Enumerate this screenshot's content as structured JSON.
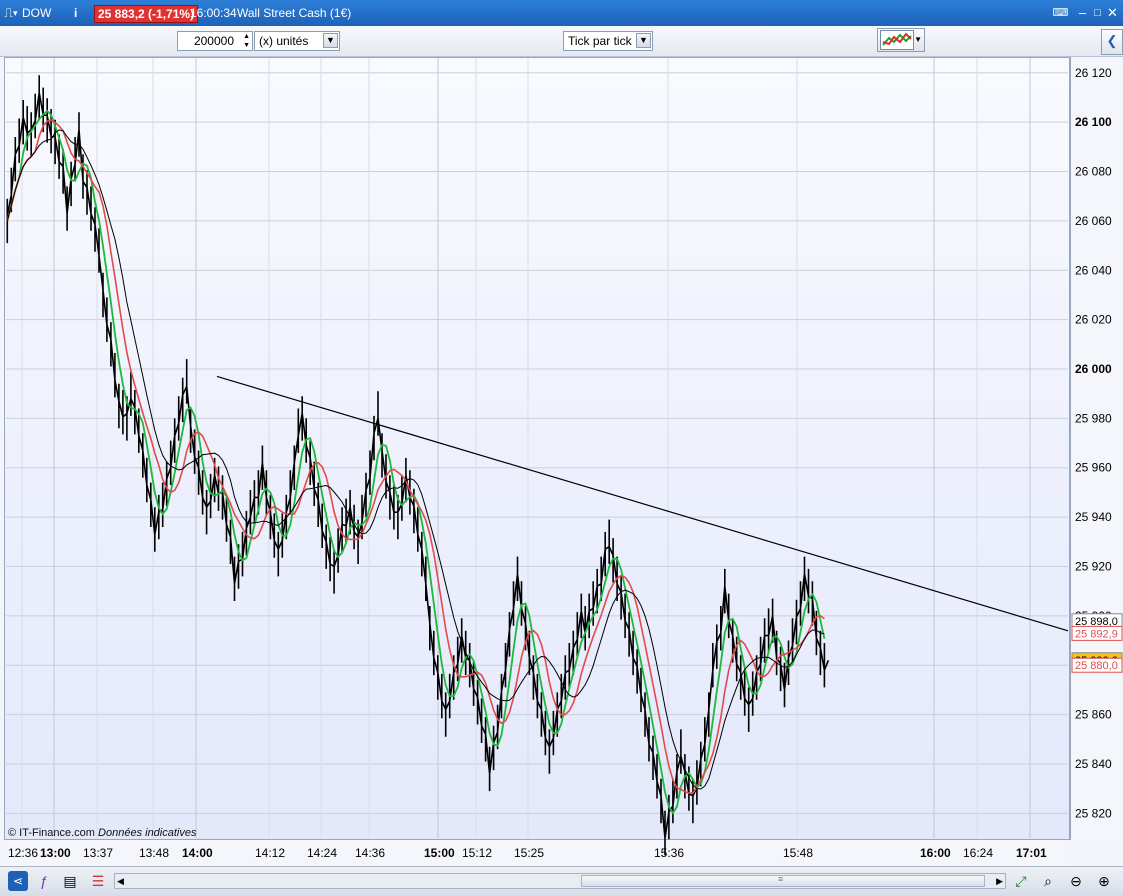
{
  "window": {
    "symbol": "DOW",
    "price_badge": "25 883,2 (-1,71%)",
    "time": "16:00:34",
    "instrument": "Wall Street Cash (1€)"
  },
  "toolbar": {
    "quantity_value": "200000",
    "unit_select": "(x) unités",
    "interval_select": "Tick par tick"
  },
  "footer": {
    "copyright": "© IT-Finance.com",
    "disclaimer": "Données indicatives"
  },
  "colors": {
    "price_badge": "#e23131",
    "ma_fast": "#1fb83a",
    "ma_medium": "#e24b4b",
    "ma_slow": "#000000",
    "current_price_badge": "#f5c518"
  },
  "chart_data": {
    "type": "line",
    "title": "",
    "xlabel": "",
    "ylabel": "",
    "ylim": [
      25810,
      26126
    ],
    "y_ticks": [
      25820,
      25840,
      25860,
      25880,
      25900,
      25920,
      25940,
      25960,
      25980,
      26000,
      26020,
      26040,
      26060,
      26080,
      26100,
      26120
    ],
    "y_tick_labels": [
      "25 820",
      "25 840",
      "25 860",
      "25 880",
      "25 900",
      "25 920",
      "25 940",
      "25 960",
      "25 980",
      "26 000",
      "26 020",
      "26 040",
      "26 060",
      "26 080",
      "26 100",
      "26 120"
    ],
    "x_tick_labels": [
      "12:36",
      "13:00",
      "13:37",
      "13:48",
      "14:00",
      "14:12",
      "14:24",
      "14:36",
      "15:00",
      "15:12",
      "15:25",
      "15:36",
      "15:48",
      "16:00",
      "16:24",
      "17:01"
    ],
    "bold_x_ticks": [
      "13:00",
      "14:00",
      "15:00",
      "16:00",
      "17:01"
    ],
    "bold_y_ticks": [
      26000,
      26100
    ],
    "series": [
      {
        "style": "tick-bars",
        "points": [
          [
            0,
            26060
          ],
          [
            2,
            26085
          ],
          [
            4,
            26100
          ],
          [
            6,
            26095
          ],
          [
            8,
            26110
          ],
          [
            9,
            26105
          ],
          [
            12,
            26092
          ],
          [
            14,
            26080
          ],
          [
            15,
            26065
          ],
          [
            17,
            26085
          ],
          [
            18,
            26095
          ],
          [
            19,
            26078
          ],
          [
            21,
            26065
          ],
          [
            23,
            26048
          ],
          [
            24,
            26030
          ],
          [
            26,
            26010
          ],
          [
            28,
            25985
          ],
          [
            30,
            25980
          ],
          [
            31,
            25990
          ],
          [
            33,
            25975
          ],
          [
            35,
            25955
          ],
          [
            37,
            25935
          ],
          [
            39,
            25945
          ],
          [
            41,
            25962
          ],
          [
            43,
            25980
          ],
          [
            45,
            25995
          ],
          [
            46,
            25975
          ],
          [
            48,
            25958
          ],
          [
            50,
            25942
          ],
          [
            52,
            25955
          ],
          [
            54,
            25948
          ],
          [
            56,
            25930
          ],
          [
            57,
            25915
          ],
          [
            59,
            25925
          ],
          [
            61,
            25942
          ],
          [
            63,
            25950
          ],
          [
            64,
            25960
          ],
          [
            66,
            25940
          ],
          [
            68,
            25925
          ],
          [
            70,
            25940
          ],
          [
            72,
            25960
          ],
          [
            73,
            25975
          ],
          [
            74,
            25980
          ],
          [
            76,
            25962
          ],
          [
            78,
            25945
          ],
          [
            80,
            25928
          ],
          [
            82,
            25918
          ],
          [
            84,
            25935
          ],
          [
            86,
            25942
          ],
          [
            88,
            25930
          ],
          [
            89,
            25940
          ],
          [
            91,
            25958
          ],
          [
            92,
            25972
          ],
          [
            93,
            25982
          ],
          [
            94,
            25965
          ],
          [
            96,
            25948
          ],
          [
            98,
            25940
          ],
          [
            100,
            25955
          ],
          [
            101,
            25950
          ],
          [
            103,
            25935
          ],
          [
            105,
            25915
          ],
          [
            106,
            25895
          ],
          [
            108,
            25875
          ],
          [
            110,
            25860
          ],
          [
            112,
            25875
          ],
          [
            114,
            25890
          ],
          [
            116,
            25880
          ],
          [
            118,
            25865
          ],
          [
            120,
            25850
          ],
          [
            121,
            25838
          ],
          [
            123,
            25855
          ],
          [
            125,
            25880
          ],
          [
            127,
            25905
          ],
          [
            128,
            25915
          ],
          [
            130,
            25895
          ],
          [
            132,
            25875
          ],
          [
            134,
            25860
          ],
          [
            136,
            25845
          ],
          [
            138,
            25860
          ],
          [
            140,
            25875
          ],
          [
            142,
            25885
          ],
          [
            144,
            25900
          ],
          [
            145,
            25895
          ],
          [
            147,
            25905
          ],
          [
            149,
            25915
          ],
          [
            150,
            25925
          ],
          [
            151,
            25930
          ],
          [
            153,
            25915
          ],
          [
            155,
            25900
          ],
          [
            157,
            25885
          ],
          [
            159,
            25870
          ],
          [
            161,
            25850
          ],
          [
            163,
            25835
          ],
          [
            164,
            25825
          ],
          [
            165,
            25812
          ],
          [
            167,
            25825
          ],
          [
            169,
            25845
          ],
          [
            170,
            25835
          ],
          [
            172,
            25825
          ],
          [
            174,
            25840
          ],
          [
            176,
            25860
          ],
          [
            177,
            25880
          ],
          [
            179,
            25895
          ],
          [
            180,
            25910
          ],
          [
            182,
            25890
          ],
          [
            184,
            25875
          ],
          [
            186,
            25862
          ],
          [
            188,
            25875
          ],
          [
            190,
            25890
          ],
          [
            192,
            25898
          ],
          [
            193,
            25885
          ],
          [
            195,
            25872
          ],
          [
            197,
            25890
          ],
          [
            199,
            25905
          ],
          [
            200,
            25915
          ],
          [
            202,
            25905
          ],
          [
            203,
            25893
          ],
          [
            204,
            25885
          ],
          [
            205,
            25880
          ]
        ]
      },
      {
        "name_hidden": true,
        "color_key": "ma_fast",
        "window": 4
      },
      {
        "name_hidden": true,
        "color_key": "ma_medium",
        "window": 8
      },
      {
        "name_hidden": true,
        "color_key": "ma_slow",
        "window": 12
      }
    ],
    "trendline": {
      "from": [
        43,
        25997
      ],
      "to": [
        235,
        25898
      ]
    },
    "x_span": [
      0,
      235
    ],
    "right_labels": [
      {
        "text": "25 898,0",
        "value": 25898.0,
        "style": "plain"
      },
      {
        "text": "25 892,9",
        "value": 25892.9,
        "style": "red"
      },
      {
        "text": "25 882,2",
        "value": 25882.2,
        "style": "current"
      },
      {
        "text": "25 880,0",
        "value": 25880.0,
        "style": "red"
      }
    ],
    "grid": true
  }
}
